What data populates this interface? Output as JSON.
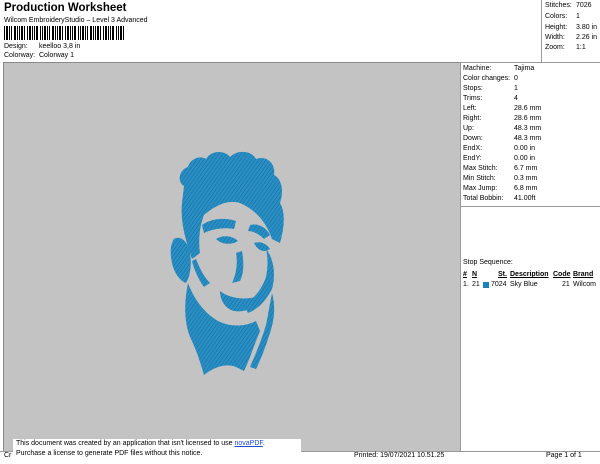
{
  "header": {
    "title": "Production Worksheet",
    "software": "Wilcom EmbroideryStudio – Level 3 Advanced",
    "design_label": "Design:",
    "design_value": "keelloo 3,8 in",
    "colorway_label": "Colorway:",
    "colorway_value": "Colorway 1"
  },
  "summary": [
    {
      "label": "Stitches:",
      "value": "7026"
    },
    {
      "label": "Colors:",
      "value": "1"
    },
    {
      "label": "Height:",
      "value": "3.80 in"
    },
    {
      "label": "Width:",
      "value": "2.26 in"
    },
    {
      "label": "Zoom:",
      "value": "1:1"
    }
  ],
  "machine": [
    {
      "label": "Machine:",
      "value": "Tajima"
    },
    {
      "label": "Color changes:",
      "value": "0"
    },
    {
      "label": "Stops:",
      "value": "1"
    },
    {
      "label": "Trims:",
      "value": "4"
    },
    {
      "label": "Left:",
      "value": "28.6 mm"
    },
    {
      "label": "Right:",
      "value": "28.6 mm"
    },
    {
      "label": "Up:",
      "value": "48.3 mm"
    },
    {
      "label": "Down:",
      "value": "48.3 mm"
    },
    {
      "label": "EndX:",
      "value": "0.00 in"
    },
    {
      "label": "EndY:",
      "value": "0.00 in"
    },
    {
      "label": "Max Stitch:",
      "value": "6.7 mm"
    },
    {
      "label": "Min Stitch:",
      "value": "0.3 mm"
    },
    {
      "label": "Max Jump:",
      "value": "6.8 mm"
    },
    {
      "label": "Total Bobbin:",
      "value": "41.00ft"
    }
  ],
  "stop_sequence": {
    "title": "Stop Sequence:",
    "headers": {
      "num": "#",
      "n": "N",
      "st": "St.",
      "desc": "Description",
      "code": "Code",
      "brand": "Brand"
    },
    "row": {
      "num": "1.",
      "n": "21",
      "st": "7024",
      "desc": "Sky Blue",
      "code": "21",
      "brand": "Wilcom"
    },
    "swatch_color": "#1a80c0"
  },
  "notice": {
    "line1": "This document was created by an application that isn't licensed to use ",
    "link": "novaPDF",
    "line1_end": ".",
    "line2": "Purchase a license to generate PDF files without this notice."
  },
  "footer": {
    "left": "Cr",
    "printed": "Printed: 19/07/2021 10.51.25",
    "page": "Page 1 of 1"
  },
  "design_color": "#1a80c0"
}
